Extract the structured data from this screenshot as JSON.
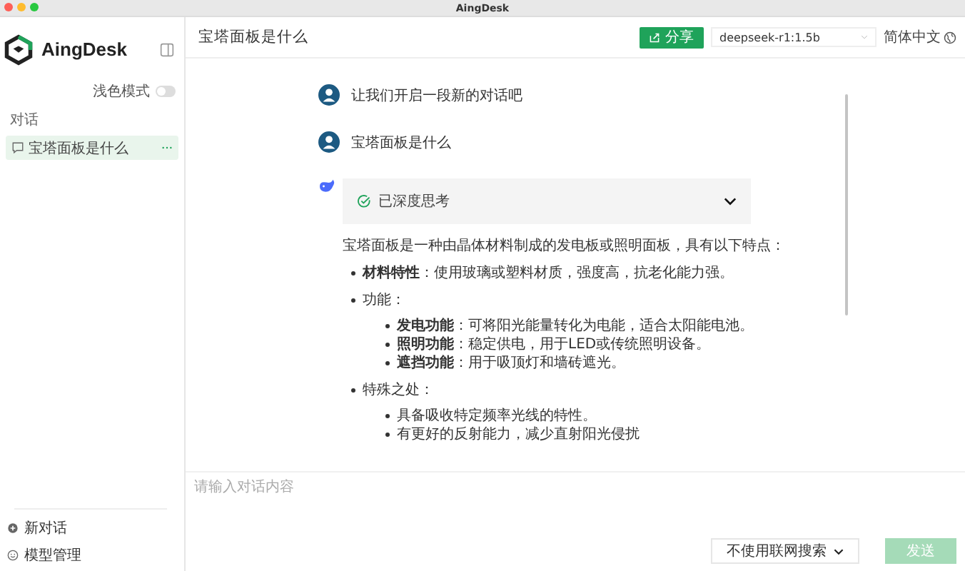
{
  "window": {
    "title": "AingDesk"
  },
  "sidebar": {
    "brand": "AingDesk",
    "theme_toggle": {
      "label": "浅色模式",
      "on": false
    },
    "section_label": "对话",
    "conversations": [
      {
        "title": "宝塔面板是什么",
        "selected": true
      }
    ],
    "footer_items": [
      {
        "kind": "new",
        "label": "新对话"
      },
      {
        "kind": "models",
        "label": "模型管理"
      }
    ]
  },
  "header": {
    "title": "宝塔面板是什么",
    "share_button": "分享",
    "model_select": "deepseek-r1:1.5b",
    "language": "简体中文"
  },
  "messages": [
    {
      "kind": "user",
      "text": "让我们开启一段新的对话吧"
    },
    {
      "kind": "user",
      "text": "宝塔面板是什么"
    },
    {
      "kind": "assistant",
      "thinking": {
        "label": "已深度思考",
        "expanded": false
      },
      "intro": "宝塔面板是一种由晶体材料制成的发电板或照明面板，具有以下特点：",
      "points": [
        {
          "text": "**材料特性**：使用玻璃或塑料材质，强度高，抗老化能力强。"
        },
        {
          "text": "功能：",
          "children": [
            {
              "text": "**发电功能**：可将阳光能量转化为电能，适合太阳能电池。"
            },
            {
              "text": "**照明功能**：稳定供电，用于LED或传统照明设备。"
            },
            {
              "text": "**遮挡功能**：用于吸顶灯和墙砖遮光。"
            }
          ]
        },
        {
          "text": "特殊之处：",
          "children": [
            {
              "text": "具备吸收特定频率光线的特性。"
            },
            {
              "text": "有更好的反射能力，减少直射阳光侵扰"
            }
          ]
        }
      ]
    }
  ],
  "input": {
    "placeholder": "请输入对话内容",
    "search_mode": "不使用联网搜索",
    "send_button": "发送",
    "send_disabled": true
  }
}
